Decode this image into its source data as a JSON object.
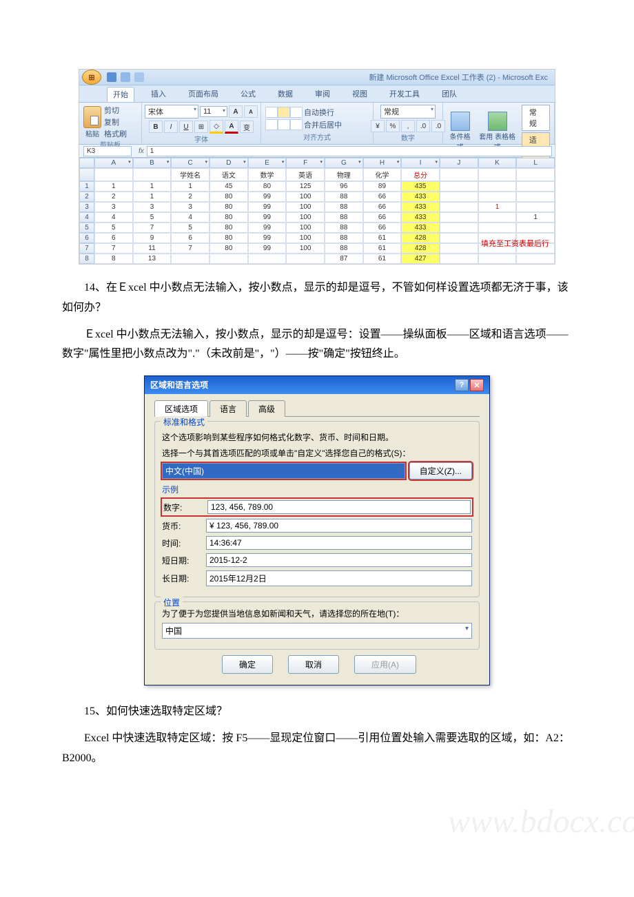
{
  "excel": {
    "title": "新建 Microsoft Office Excel 工作表 (2) - Microsoft Exc",
    "tabs": [
      "开始",
      "插入",
      "页面布局",
      "公式",
      "数据",
      "审阅",
      "视图",
      "开发工具",
      "团队"
    ],
    "clipboard": {
      "cut": "剪切",
      "copy": "复制",
      "format": "格式刷",
      "paste": "粘贴",
      "label": "剪贴板"
    },
    "font": {
      "name": "宋体",
      "size": "11",
      "label": "字体"
    },
    "align": {
      "wrap": "自动换行",
      "merge": "合并后居中",
      "label": "对齐方式"
    },
    "number": {
      "format": "常规",
      "label": "数字"
    },
    "styles": {
      "cond": "条件格式",
      "table": "套用\n表格格式",
      "normal": "常规",
      "mid": "适中"
    },
    "namebox": "K3",
    "fx": "1",
    "cols": [
      "",
      "A",
      "B",
      "C",
      "D",
      "E",
      "F",
      "G",
      "H",
      "I",
      "J",
      "K",
      "L"
    ],
    "header_row": [
      "",
      "",
      "",
      "学姓名",
      "语文",
      "数学",
      "英语",
      "物理",
      "化学",
      "总分",
      "",
      "",
      ""
    ],
    "rows": [
      [
        "1",
        "1",
        "1",
        "1",
        "45",
        "80",
        "125",
        "96",
        "89",
        "435",
        "",
        "",
        ""
      ],
      [
        "2",
        "2",
        "1",
        "2",
        "80",
        "99",
        "100",
        "88",
        "66",
        "433",
        "",
        "",
        ""
      ],
      [
        "3",
        "3",
        "3",
        "3",
        "80",
        "99",
        "100",
        "88",
        "66",
        "433",
        "",
        "1",
        ""
      ],
      [
        "4",
        "4",
        "5",
        "4",
        "80",
        "99",
        "100",
        "88",
        "66",
        "433",
        "",
        "",
        "1"
      ],
      [
        "5",
        "5",
        "7",
        "5",
        "80",
        "99",
        "100",
        "88",
        "66",
        "433",
        "",
        "",
        ""
      ],
      [
        "6",
        "6",
        "9",
        "6",
        "80",
        "99",
        "100",
        "88",
        "61",
        "428",
        "",
        "",
        ""
      ],
      [
        "7",
        "7",
        "11",
        "7",
        "80",
        "99",
        "100",
        "88",
        "61",
        "428",
        "",
        "",
        ""
      ],
      [
        "8",
        "8",
        "13",
        "",
        "",
        "",
        "",
        "87",
        "61",
        "427",
        "",
        "",
        ""
      ]
    ],
    "note": "填充至工资表最后行"
  },
  "text": {
    "p1": "14、在Ｅxcel 中小数点无法输入，按小数点，显示的却是逗号，不管如何样设置选项都无济于事，该如何办？",
    "p2": "Ｅxcel 中小数点无法输入，按小数点，显示的却是逗号：设置——操纵面板——区域和语言选项——数字\"属性里把小数点改为\".\"（未改前是\"，\"）——按\"确定\"按钮终止。",
    "p3": "15、如何快速选取特定区域？",
    "p4": "Excel 中快速选取特定区域：按 F5——显现定位窗口——引用位置处输入需要选取的区域，如：A2：B2000。"
  },
  "dialog": {
    "title": "区域和语言选项",
    "tabs": [
      "区域选项",
      "语言",
      "高级"
    ],
    "group1": "标准和格式",
    "desc1": "这个选项影响到某些程序如何格式化数字、货币、时间和日期。",
    "desc2": "选择一个与其首选项匹配的项或单击\"自定义\"选择您自己的格式(S)：",
    "locale": "中文(中国)",
    "custom": "自定义(Z)...",
    "example_label": "示例",
    "rows": {
      "number_l": "数字:",
      "number_v": "123, 456, 789.00",
      "currency_l": "货币:",
      "currency_v": "¥ 123, 456, 789.00",
      "time_l": "时间:",
      "time_v": "14:36:47",
      "sdate_l": "短日期:",
      "sdate_v": "2015-12-2",
      "ldate_l": "长日期:",
      "ldate_v": "2015年12月2日"
    },
    "group2": "位置",
    "desc3": "为了便于为您提供当地信息如新闻和天气，请选择您的所在地(T)：",
    "location": "中国",
    "ok": "确定",
    "cancel": "取消",
    "apply": "应用(A)"
  },
  "watermark": "www.bdocx.com"
}
